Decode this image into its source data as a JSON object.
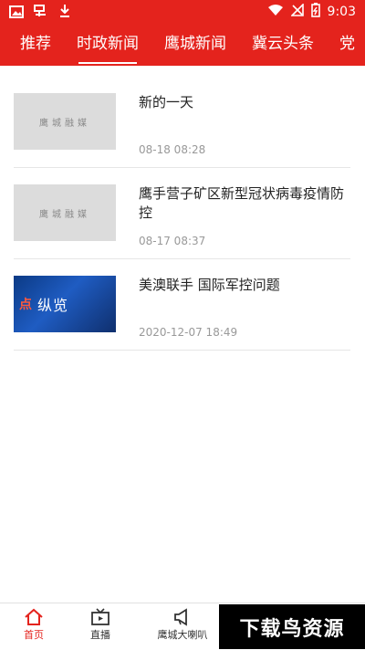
{
  "status_bar": {
    "time": "9:03"
  },
  "tabs": [
    {
      "label": "推荐",
      "active": false
    },
    {
      "label": "时政新闻",
      "active": true
    },
    {
      "label": "鹰城新闻",
      "active": false
    },
    {
      "label": "冀云头条",
      "active": false
    },
    {
      "label": "党",
      "active": false
    }
  ],
  "news": [
    {
      "title": "新的一天",
      "time": "08-18 08:28",
      "thumb_text": "鹰城融媒"
    },
    {
      "title": "鹰手营子矿区新型冠状病毒疫情防控",
      "time": "08-17 08:37",
      "thumb_text": "鹰城融媒"
    },
    {
      "title": "美澳联手 国际军控问题",
      "time": "2020-12-07 18:49",
      "thumb_mark": "点",
      "thumb_text": "纵览"
    }
  ],
  "bottom_nav": [
    {
      "label": "首页",
      "active": true
    },
    {
      "label": "直播",
      "active": false
    },
    {
      "label": "鹰城大喇叭",
      "active": false
    }
  ],
  "watermark": "下载鸟资源",
  "colors": {
    "accent": "#e4231d"
  }
}
